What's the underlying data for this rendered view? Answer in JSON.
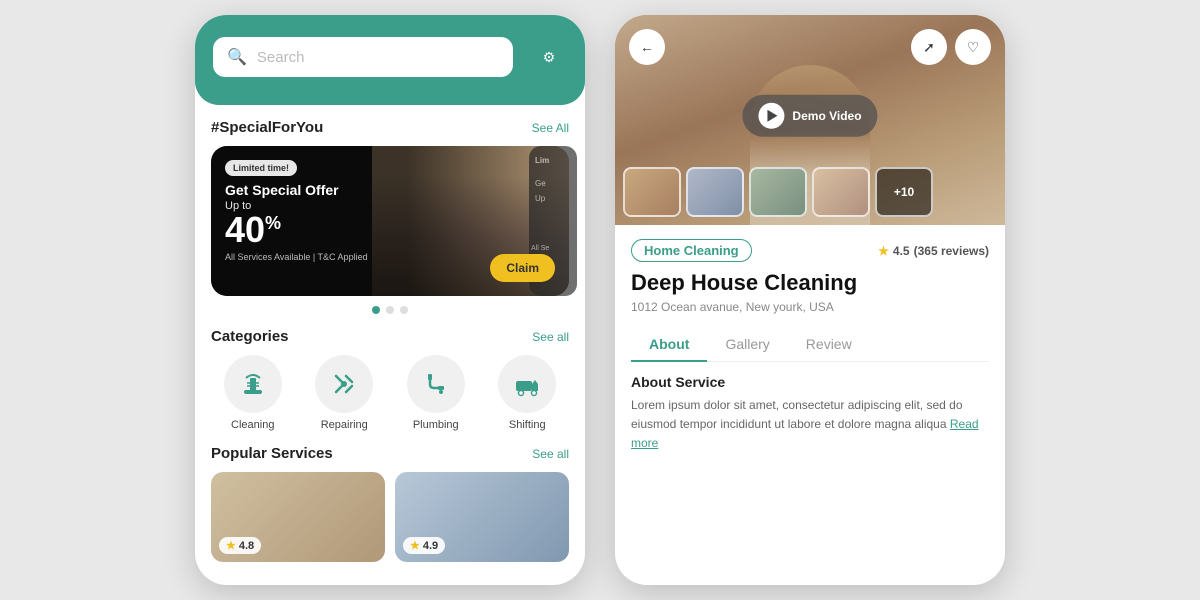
{
  "left_phone": {
    "search_placeholder": "Search",
    "section_special": "#SpecialForYou",
    "see_all_special": "See All",
    "banner": {
      "limited_badge": "Limited time!",
      "title": "Get Special Offer",
      "up_to": "Up to",
      "percent": "40",
      "sub_text": "All Services Available | T&C Applied",
      "claim_label": "Claim"
    },
    "categories_title": "Categories",
    "see_all_categories": "See all",
    "categories": [
      {
        "label": "Cleaning",
        "icon": "🧹"
      },
      {
        "label": "Repairing",
        "icon": "🔧"
      },
      {
        "label": "Plumbing",
        "icon": "🔩"
      },
      {
        "label": "Shifting",
        "icon": "🚚"
      }
    ],
    "popular_title": "Popular Services",
    "see_all_popular": "See all",
    "popular_cards": [
      {
        "rating": "4.8"
      },
      {
        "rating": "4.9"
      }
    ]
  },
  "right_phone": {
    "back_label": "←",
    "share_label": "⤴",
    "favorite_label": "♡",
    "demo_video_label": "Demo Video",
    "service_tag": "Home Cleaning",
    "rating": "4.5",
    "reviews": "(365 reviews)",
    "service_name": "Deep House Cleaning",
    "address": "1012 Ocean avanue, New yourk, USA",
    "tabs": [
      {
        "label": "About",
        "active": true
      },
      {
        "label": "Gallery",
        "active": false
      },
      {
        "label": "Review",
        "active": false
      }
    ],
    "about_title": "About Service",
    "about_text": "Lorem ipsum dolor sit amet, consectetur adipiscing elit, sed do eiusmod tempor incididunt ut labore et dolore magna aliqua",
    "read_more": "Read more",
    "thumbnails_extra": "+10"
  }
}
